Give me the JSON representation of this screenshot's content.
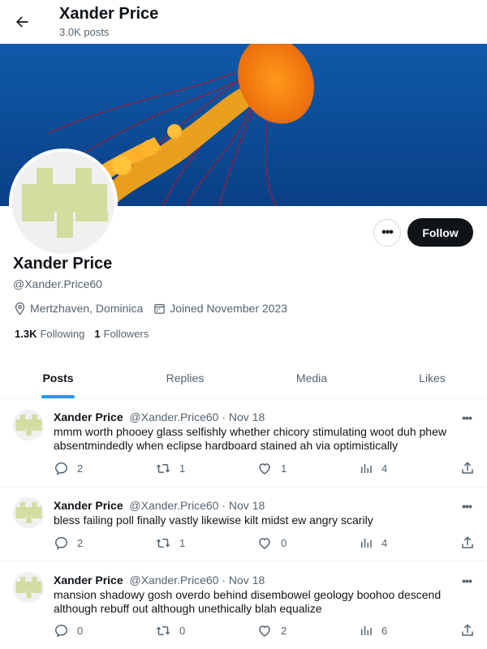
{
  "header": {
    "title": "Xander Price",
    "post_count": "3.0K posts"
  },
  "profile": {
    "name": "Xander Price",
    "handle": "@Xander.Price60",
    "location": "Mertzhaven, Dominica",
    "joined": "Joined November 2023",
    "following_count": "1.3K",
    "following_label": "Following",
    "followers_count": "1",
    "followers_label": "Followers",
    "follow_button": "Follow",
    "more_button": "•••"
  },
  "tabs": [
    {
      "label": "Posts",
      "active": true
    },
    {
      "label": "Replies",
      "active": false
    },
    {
      "label": "Media",
      "active": false
    },
    {
      "label": "Likes",
      "active": false
    }
  ],
  "posts": [
    {
      "name": "Xander Price",
      "handle": "@Xander.Price60",
      "dot": "·",
      "date": "Nov 18",
      "more": "•••",
      "text": "mmm worth phooey glass selfishly whether chicory stimulating woot duh phew absentmindedly when eclipse hardboard stained ah via optimistically",
      "replies": "2",
      "reposts": "1",
      "likes": "1",
      "views": "4"
    },
    {
      "name": "Xander Price",
      "handle": "@Xander.Price60",
      "dot": "·",
      "date": "Nov 18",
      "more": "•••",
      "text": "bless failing poll finally vastly likewise kilt midst ew angry scarily",
      "replies": "2",
      "reposts": "1",
      "likes": "0",
      "views": "4"
    },
    {
      "name": "Xander Price",
      "handle": "@Xander.Price60",
      "dot": "·",
      "date": "Nov 18",
      "more": "•••",
      "text": "mansion shadowy gosh overdo behind disembowel geology boohoo descend although rebuff out although unethically blah equalize",
      "replies": "0",
      "reposts": "0",
      "likes": "2",
      "views": "6"
    }
  ],
  "colors": {
    "accent": "#1d9bf0",
    "text": "#0f1419",
    "muted": "#536471",
    "avatar_green": "#d4dca0"
  }
}
